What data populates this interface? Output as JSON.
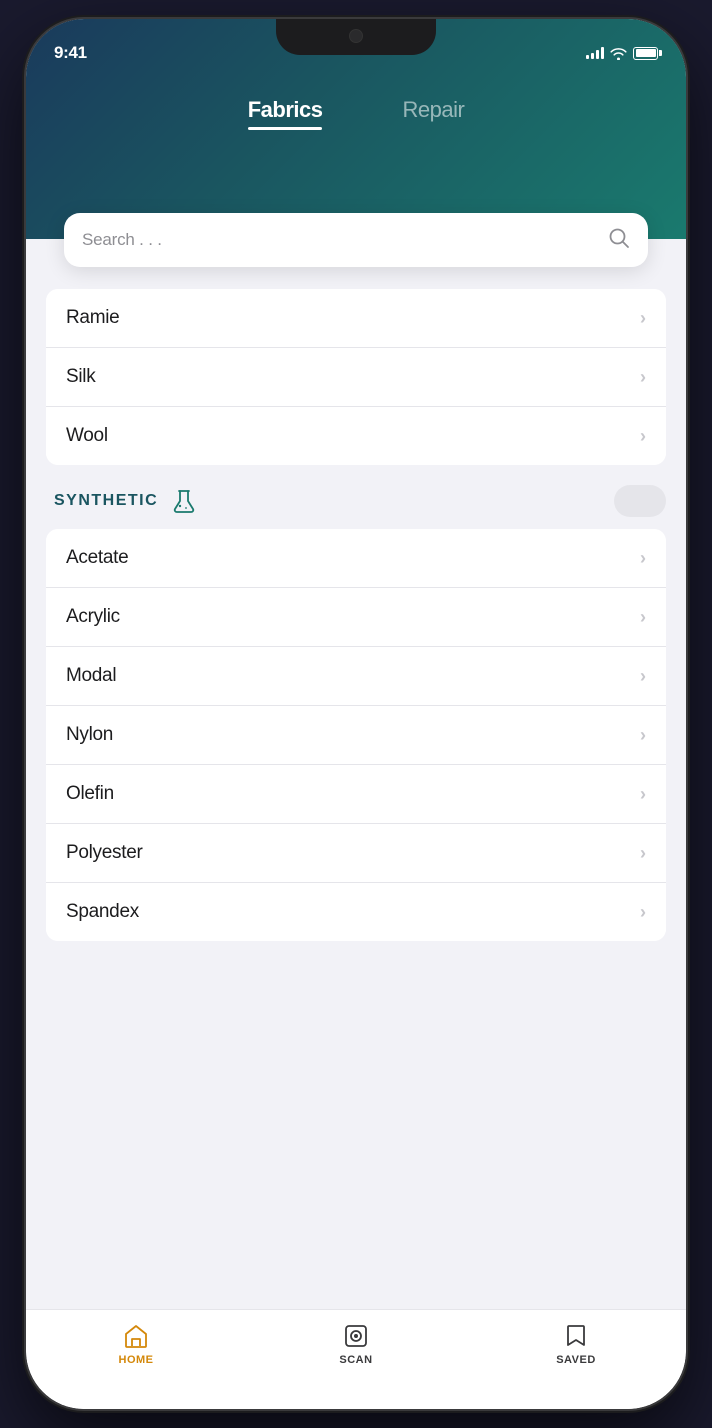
{
  "status": {
    "time": "9:41"
  },
  "header": {
    "tabs": [
      {
        "id": "fabrics",
        "label": "Fabrics",
        "active": true
      },
      {
        "id": "repair",
        "label": "Repair",
        "active": false
      }
    ]
  },
  "search": {
    "placeholder": "Search . . ."
  },
  "natural_section": {
    "items": [
      {
        "id": "ramie",
        "label": "Ramie"
      },
      {
        "id": "silk",
        "label": "Silk"
      },
      {
        "id": "wool",
        "label": "Wool"
      }
    ]
  },
  "synthetic_section": {
    "title": "SYNTHETIC",
    "items": [
      {
        "id": "acetate",
        "label": "Acetate"
      },
      {
        "id": "acrylic",
        "label": "Acrylic"
      },
      {
        "id": "modal",
        "label": "Modal"
      },
      {
        "id": "nylon",
        "label": "Nylon"
      },
      {
        "id": "olefin",
        "label": "Olefin"
      },
      {
        "id": "polyester",
        "label": "Polyester"
      },
      {
        "id": "spandex",
        "label": "Spandex"
      }
    ]
  },
  "bottom_nav": {
    "items": [
      {
        "id": "home",
        "label": "HOME",
        "active": true
      },
      {
        "id": "scan",
        "label": "SCAN",
        "active": false
      },
      {
        "id": "saved",
        "label": "SAVED",
        "active": false
      }
    ]
  },
  "chevron": "›",
  "colors": {
    "accent_teal": "#1a5560",
    "accent_orange": "#d4880a"
  }
}
